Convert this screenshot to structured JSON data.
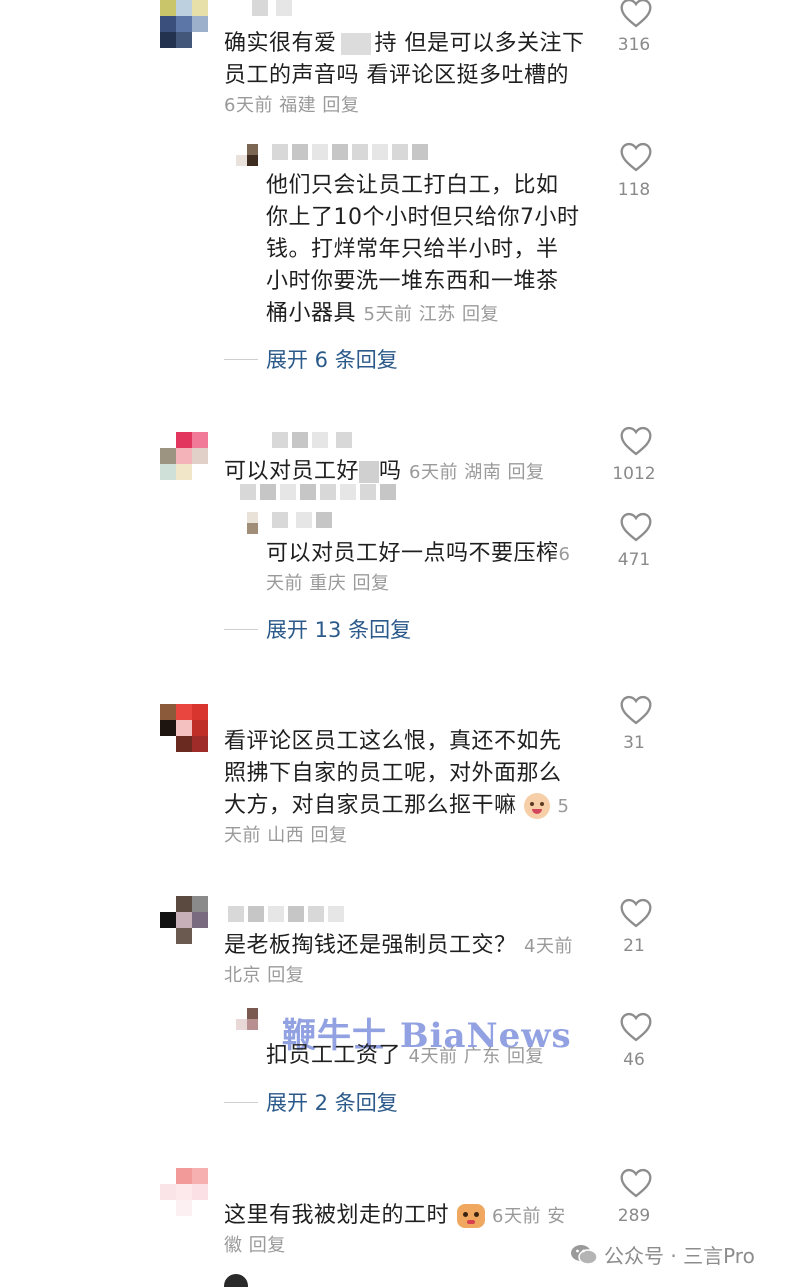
{
  "comments": [
    {
      "id": "c1",
      "text_lines": [
        "确实很有爱心",
        "员工的声音吗 看评论区挺多吐槽的"
      ],
      "text_line1_visible": "…持 但是可以多关注下",
      "time": "6天前",
      "location": "福建",
      "reply": "回复",
      "likes": "316",
      "replies": [
        {
          "text_lines": [
            "他们只会让员工打白工，比如",
            "你上了10个小时但只给你7小时",
            "钱。打烊常年只给半小时，半",
            "小时你要洗一堆东西和一堆茶",
            "桶小器具"
          ],
          "time": "5天前",
          "location": "江苏",
          "reply": "回复",
          "likes": "118"
        }
      ],
      "expand": "展开 6 条回复"
    },
    {
      "id": "c2",
      "text": "可以对员工好",
      "text_tail": "吗",
      "time": "6天前",
      "location": "湖南",
      "reply": "回复",
      "likes": "1012",
      "replies": [
        {
          "text_lines": [
            "可以对员工好一点吗不要压榨",
            "天前 重庆 回复"
          ],
          "line1_tail": "6",
          "likes": "471"
        }
      ],
      "expand": "展开 13 条回复"
    },
    {
      "id": "c3",
      "text_lines": [
        "看评论区员工这么恨，真还不如先",
        "照拂下自家的员工呢，对外面那么",
        "大方，对自家员工那么抠干嘛"
      ],
      "line3_tail": "5",
      "meta_line": "天前 山西 回复",
      "likes": "31"
    },
    {
      "id": "c4",
      "text": "是老板掏钱还是强制员工交？",
      "time_inline": "4天前",
      "meta_line": "北京 回复",
      "likes": "21",
      "replies": [
        {
          "text": "扣员工工资了",
          "time": "4天前",
          "location": "广东",
          "reply": "回复",
          "likes": "46"
        }
      ],
      "expand": "展开 2 条回复"
    },
    {
      "id": "c5",
      "text": "这里有我被划走的工时",
      "time_inline": "6天前 安",
      "meta_line": "徽 回复",
      "likes": "289"
    }
  ],
  "watermark": "鞭牛士 BiaNews",
  "footer": {
    "account": "公众号 · 三言Pro"
  },
  "icons": {
    "like": "heart-outline-icon",
    "emoji_cry": "crying-face-icon",
    "emoji_cat": "cat-face-icon",
    "wechat": "wechat-icon"
  },
  "colors": {
    "meta": "#9a9a9a",
    "expand": "#2b5a8a",
    "watermark": "#6e82d7"
  }
}
